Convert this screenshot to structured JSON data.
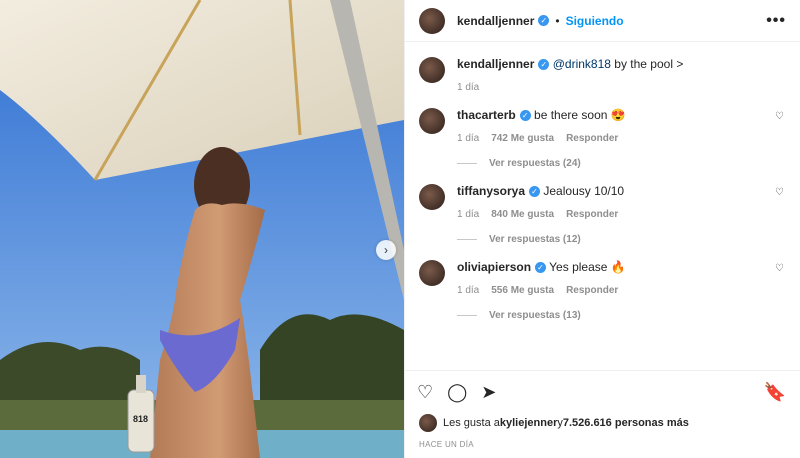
{
  "header": {
    "username": "kendalljenner",
    "verified_icon": "verified-badge-icon",
    "follow_label": "Siguiendo",
    "more_icon": "•••"
  },
  "caption": {
    "username": "kendalljenner",
    "mention": "@drink818",
    "text": " by the pool >",
    "time": "1 día"
  },
  "comments": [
    {
      "username": "thacarterb",
      "text": "be there soon 😍",
      "time": "1 día",
      "likes": "742 Me gusta",
      "reply_label": "Responder",
      "view_replies": "Ver respuestas (24)"
    },
    {
      "username": "tiffanysorya",
      "text": "Jealousy 10/10",
      "time": "1 día",
      "likes": "840 Me gusta",
      "reply_label": "Responder",
      "view_replies": "Ver respuestas (12)"
    },
    {
      "username": "oliviapierson",
      "text": "Yes please 🔥",
      "time": "1 día",
      "likes": "556 Me gusta",
      "reply_label": "Responder",
      "view_replies": "Ver respuestas (13)"
    }
  ],
  "actions": {
    "like_icon": "heart-icon",
    "comment_icon": "comment-icon",
    "share_icon": "send-icon",
    "save_icon": "bookmark-icon"
  },
  "likes": {
    "prefix": "Les gusta a ",
    "user": "kyliejenner",
    "middle": " y ",
    "count": "7.526.616 personas más"
  },
  "posted_ago": "HACE UN DÍA",
  "colors": {
    "link_blue": "#0095f6",
    "verified_blue": "#3897f0",
    "muted": "#8e8e8e"
  }
}
